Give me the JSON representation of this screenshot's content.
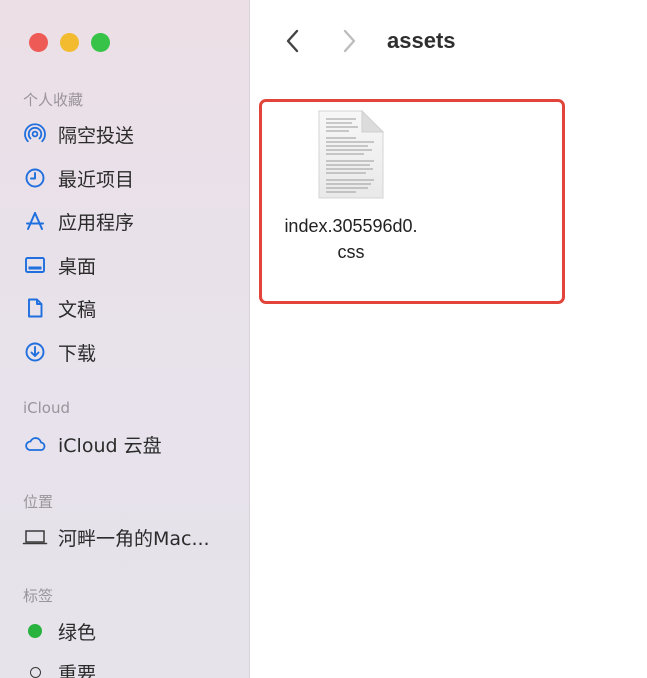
{
  "window": {
    "title": "assets"
  },
  "toolbar": {
    "back_icon": "chevron-left-icon",
    "forward_icon": "chevron-right-icon"
  },
  "sidebar": {
    "sections": {
      "favorites": "个人收藏",
      "icloud": "iCloud",
      "locations": "位置",
      "tags": "标签"
    },
    "favorites": [
      {
        "label": "隔空投送",
        "icon": "airdrop-icon"
      },
      {
        "label": "最近项目",
        "icon": "clock-icon"
      },
      {
        "label": "应用程序",
        "icon": "applications-icon"
      },
      {
        "label": "桌面",
        "icon": "desktop-icon"
      },
      {
        "label": "文稿",
        "icon": "document-icon"
      },
      {
        "label": "下载",
        "icon": "download-icon"
      }
    ],
    "icloud": [
      {
        "label": "iCloud 云盘",
        "icon": "cloud-icon"
      }
    ],
    "locations": [
      {
        "label": "河畔一角的Mac...",
        "icon": "laptop-icon"
      }
    ],
    "tags": [
      {
        "label": "绿色",
        "color": "#27b33d"
      },
      {
        "label": "重要",
        "color": "#3a3a3a"
      }
    ]
  },
  "files": [
    {
      "name_line1": "index.305596d0.",
      "name_line2": "css",
      "icon": "css-file-icon"
    }
  ],
  "colors": {
    "accent": "#1f6fde",
    "highlight": "#e2443a",
    "traffic_red": "#ee5a55",
    "traffic_yellow": "#f2bb30",
    "traffic_green": "#36c348"
  }
}
